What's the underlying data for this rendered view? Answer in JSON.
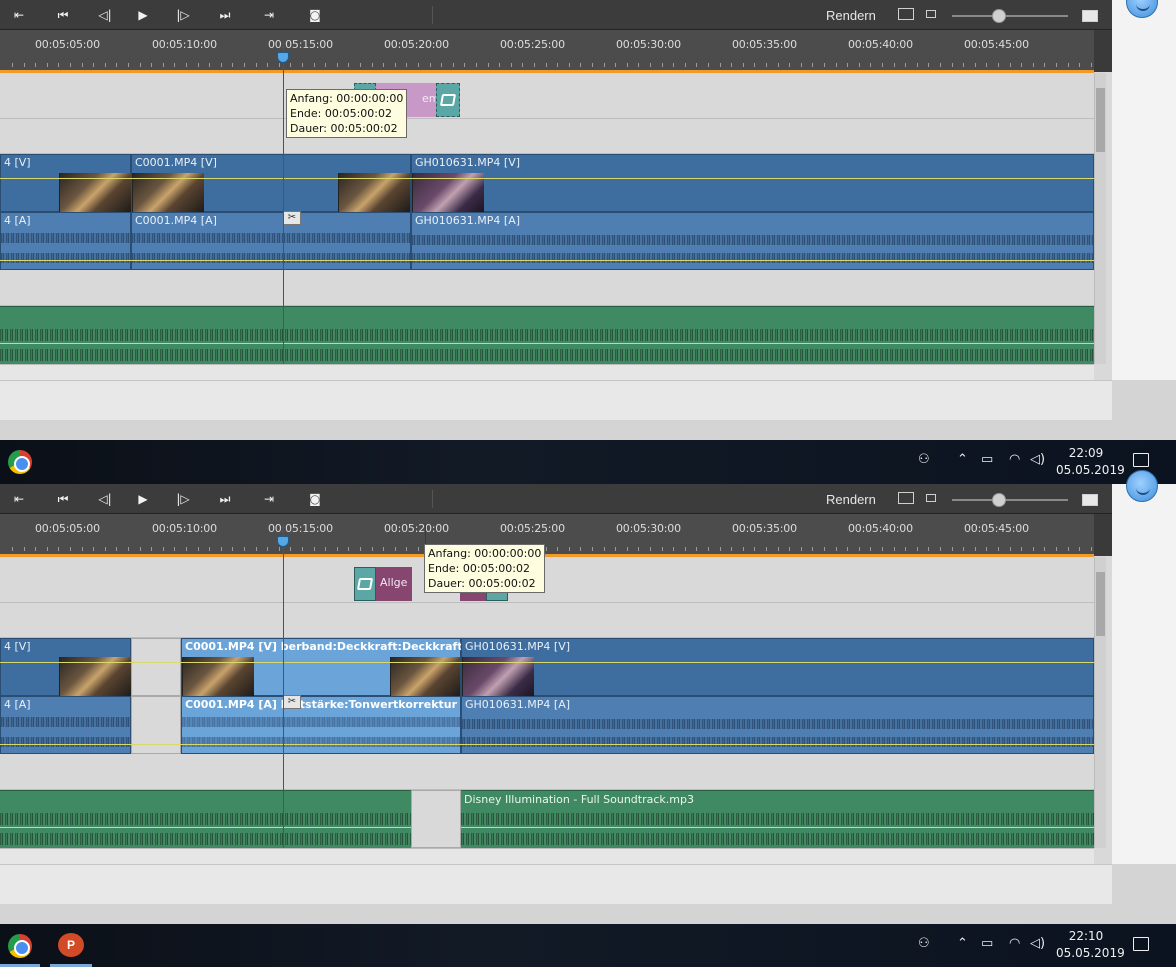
{
  "toolbar": {
    "render_label": "Rendern",
    "icons": [
      "to-start-icon",
      "skip-back-icon",
      "step-back-icon",
      "play-icon",
      "step-forward-icon",
      "skip-forward-icon",
      "to-end-icon",
      "snapshot-icon"
    ]
  },
  "ruler": {
    "ticks": [
      "00:05:05:00",
      "00:05:10:00",
      "00:05:15:00",
      "00:05:20:00",
      "00:05:25:00",
      "00:05:30:00",
      "00:05:35:00",
      "00:05:40:00",
      "00:05:45:00"
    ]
  },
  "screen1": {
    "tooltip": {
      "start": "Anfang: 00:00:00:00",
      "end": "Ende: 00:05:00:02",
      "duration": "Dauer: 00:05:00:02"
    },
    "title_clip_label": "emei",
    "video_clips": [
      {
        "label": "4 [V]"
      },
      {
        "label": "C0001.MP4 [V]"
      },
      {
        "label": "GH010631.MP4 [V]"
      }
    ],
    "audio_clips": [
      {
        "label": "4 [A]"
      },
      {
        "label": "C0001.MP4 [A]"
      },
      {
        "label": "GH010631.MP4 [A]"
      }
    ],
    "taskbar": {
      "time": "22:09",
      "date": "05.05.2019"
    }
  },
  "screen2": {
    "tooltip": {
      "start": "Anfang: 00:00:00:00",
      "end": "Ende: 00:05:00:02",
      "duration": "Dauer: 00:05:00:02"
    },
    "title_clip_label": "Allge",
    "video_clips": [
      {
        "label": "4 [V]"
      },
      {
        "label": "C0001.MP4 [V] berband:Deckkraft:Deckkraft"
      },
      {
        "label": "GH010631.MP4 [V]"
      }
    ],
    "audio_clips": [
      {
        "label": "4 [A]"
      },
      {
        "label": "C0001.MP4 [A] lautstärke:Tonwertkorrektur"
      },
      {
        "label": "GH010631.MP4 [A]"
      }
    ],
    "music_label": "Disney Illumination - Full Soundtrack.mp3",
    "taskbar": {
      "time": "22:10",
      "date": "05.05.2019"
    }
  },
  "colors": {
    "video_clip": "#3e6d9f",
    "audio_clip": "#4f7fb2",
    "selected_clip": "#6aa4d8",
    "music_track": "#3f8a62",
    "playhead": "#ee1111",
    "ruler_bar": "#f19a29",
    "title_teal": "#5aa7a5",
    "title_pink": "#c898c6",
    "title_purple": "#86466f"
  }
}
